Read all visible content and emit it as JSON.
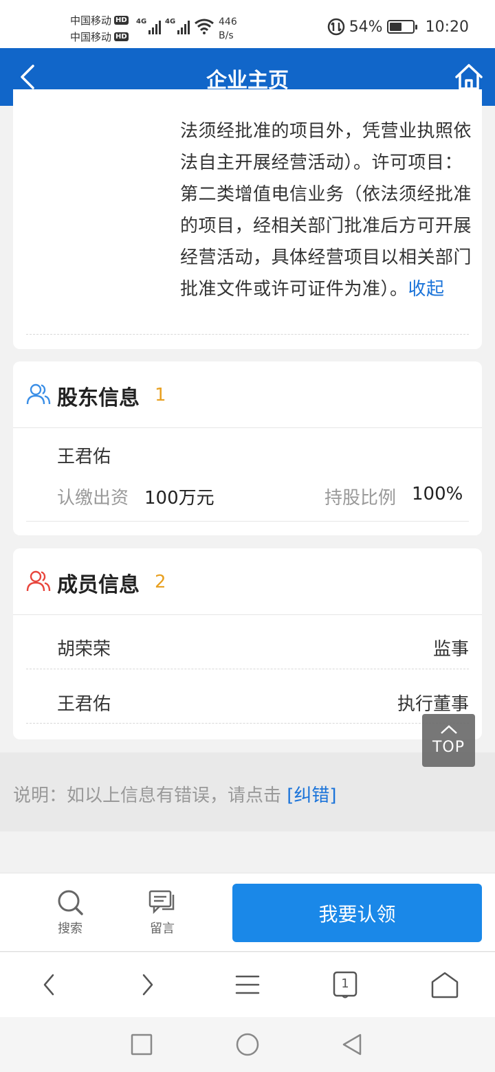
{
  "status_bar": {
    "carrier1": "中国移动",
    "carrier2": "中国移动",
    "hd": "HD",
    "net1": "4G",
    "net2": "4G",
    "net_speed_value": "446",
    "net_speed_unit": "B/s",
    "battery_pct": "54%",
    "battery_level": 0.54,
    "time": "10:20"
  },
  "header": {
    "title": "企业主页",
    "back_icon": "chevron-left-icon",
    "home_icon": "home-icon"
  },
  "business_scope": {
    "text": "法须经批准的项目外，凭营业执照依法自主开展经营活动）。许可项目：第二类增值电信业务（依法须经批准的项目，经相关部门批准后方可开展经营活动，具体经营项目以相关部门批准文件或许可证件为准）。",
    "collapse_label": "收起"
  },
  "shareholders": {
    "title": "股东信息",
    "count": "1",
    "icon_color": "#3a8ee6",
    "items": [
      {
        "name": "王君佑",
        "capital_label": "认缴出资",
        "capital_value": "100万元",
        "ratio_label": "持股比例",
        "ratio_value": "100%"
      }
    ]
  },
  "members": {
    "title": "成员信息",
    "count": "2",
    "icon_color": "#e8453c",
    "items": [
      {
        "name": "胡荣荣",
        "role": "监事"
      },
      {
        "name": "王君佑",
        "role": "执行董事"
      }
    ]
  },
  "notice": {
    "text": "说明：如以上信息有错误，请点击 ",
    "link": "[纠错]"
  },
  "top_button": {
    "label": "TOP"
  },
  "action_bar": {
    "search_label": "搜索",
    "message_label": "留言",
    "claim_label": "我要认领"
  },
  "browser_bar": {
    "tabs_count": "1"
  },
  "colors": {
    "primary": "#1166c9",
    "button": "#1a88e8",
    "link": "#1a73d9",
    "count": "#e8a020"
  }
}
